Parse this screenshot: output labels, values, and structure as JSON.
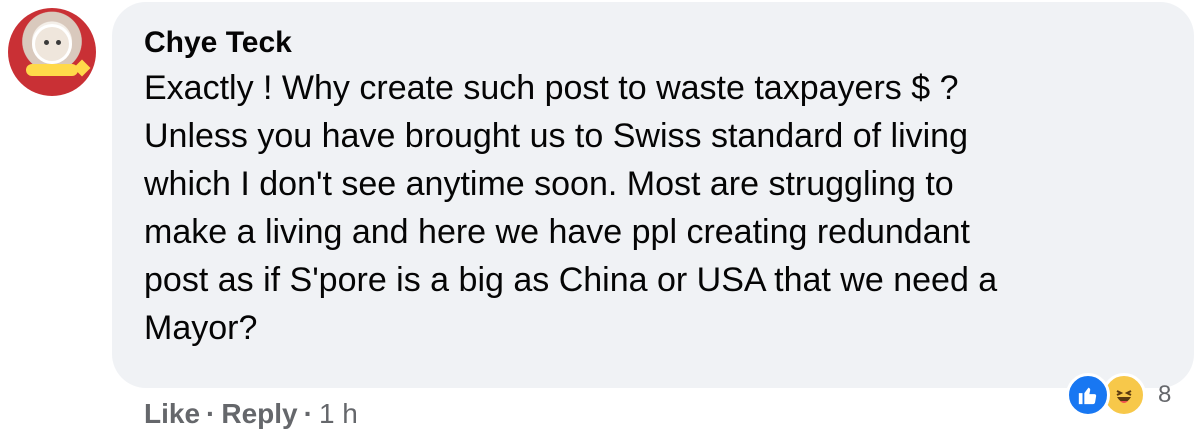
{
  "comment": {
    "author": "Chye Teck",
    "text": "Exactly ! Why create such post to waste taxpayers $ ?\nUnless you have brought us to Swiss standard of living\nwhich I don't see anytime soon. Most are struggling to\nmake a living and here we have ppl creating redundant\npost as if S'pore is a big as China or USA that we need a\nMayor?"
  },
  "reactions": {
    "icons": [
      "like-icon",
      "haha-icon"
    ],
    "count": "8"
  },
  "actions": {
    "like_label": "Like",
    "separator": "·",
    "reply_label": "Reply",
    "timestamp": "1 h"
  },
  "colors": {
    "bubble_bg": "#f0f2f5",
    "text": "#050505",
    "meta": "#65676b",
    "like_blue": "#1877f2",
    "haha_yellow": "#f7c84a"
  }
}
